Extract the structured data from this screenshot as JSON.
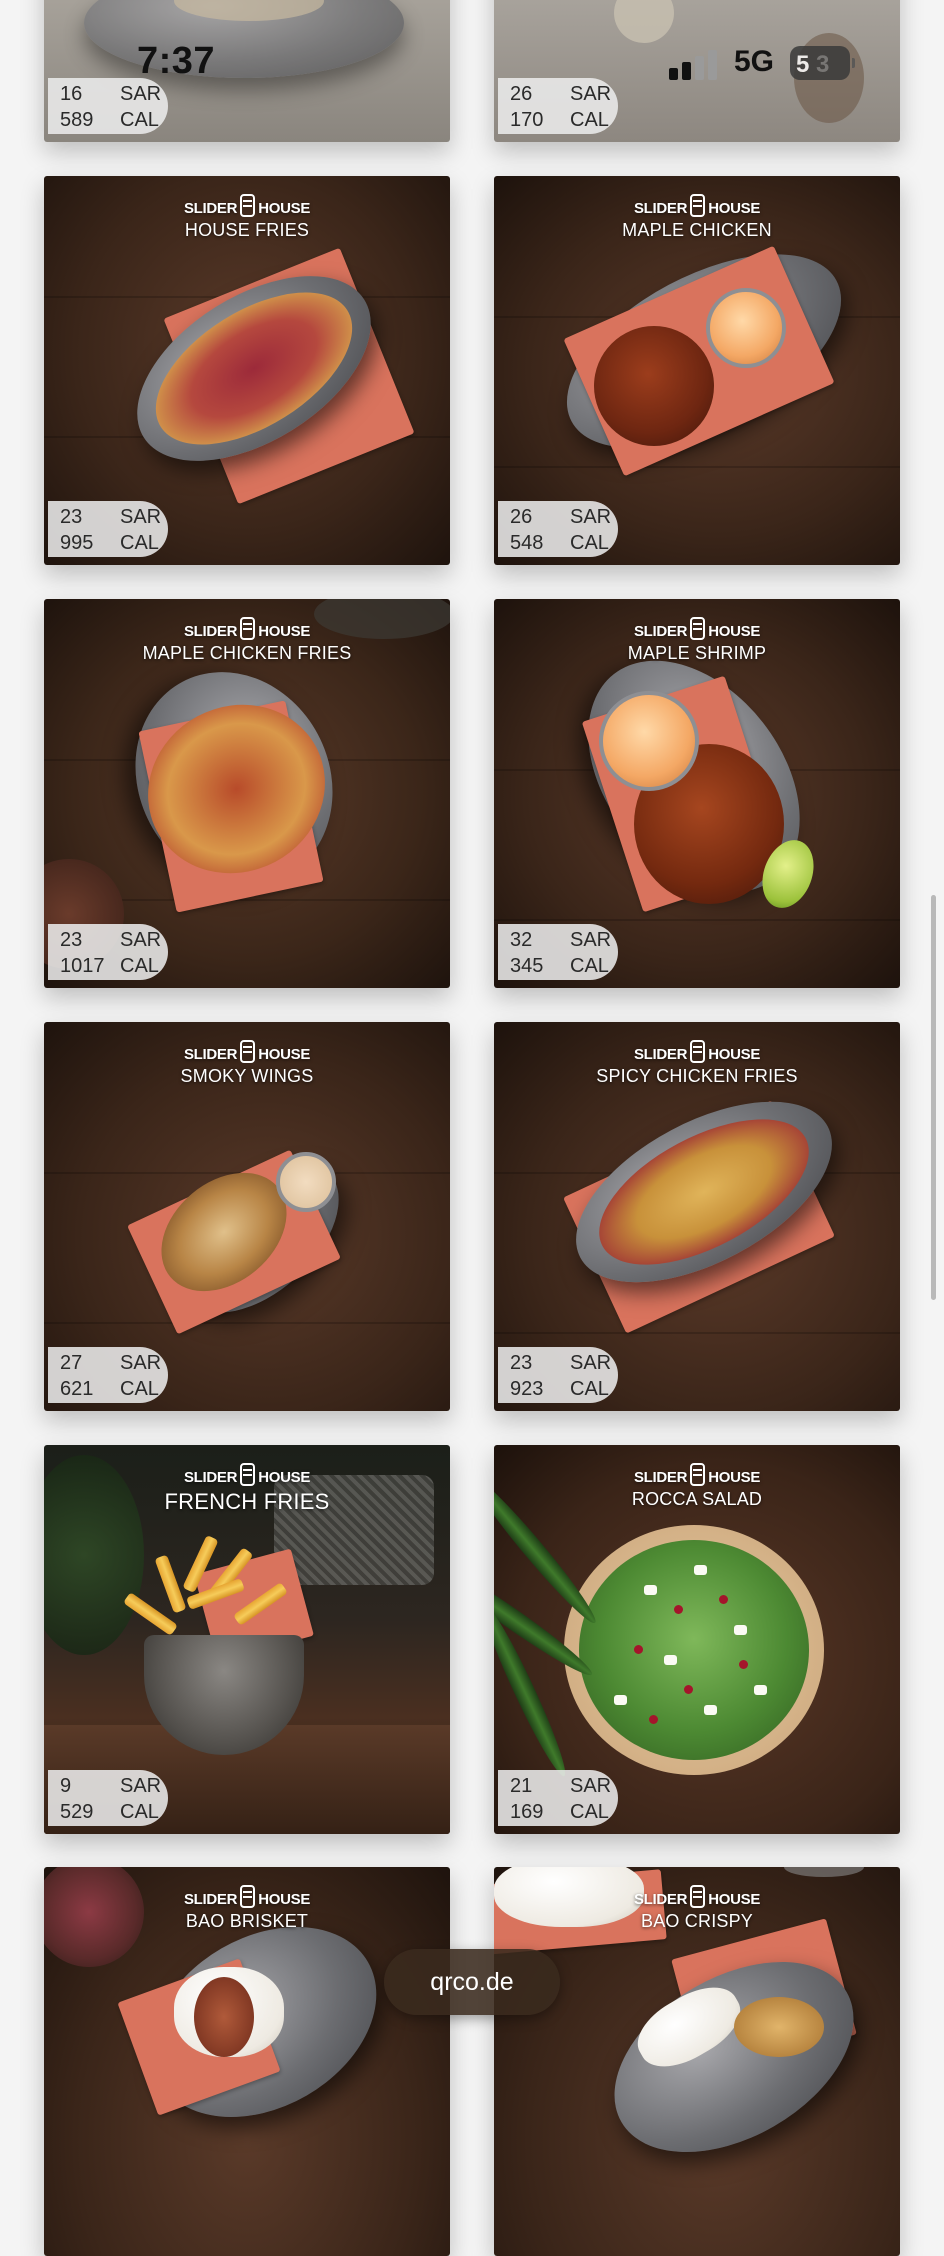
{
  "status_bar": {
    "time": "7:37",
    "network": "5G",
    "battery_level": "5",
    "battery_suffix": "3"
  },
  "brand": {
    "left_word": "SLIDER",
    "right_word": "HOUSE"
  },
  "menu": {
    "items": [
      {
        "name": "",
        "price": "16",
        "currency": "SAR",
        "calories": "589",
        "cal_unit": "CAL"
      },
      {
        "name": "",
        "price": "26",
        "currency": "SAR",
        "calories": "170",
        "cal_unit": "CAL"
      },
      {
        "name": "HOUSE FRIES",
        "price": "23",
        "currency": "SAR",
        "calories": "995",
        "cal_unit": "CAL"
      },
      {
        "name": "MAPLE CHICKEN",
        "price": "26",
        "currency": "SAR",
        "calories": "548",
        "cal_unit": "CAL"
      },
      {
        "name": "MAPLE CHICKEN FRIES",
        "price": "23",
        "currency": "SAR",
        "calories": "1017",
        "cal_unit": "CAL"
      },
      {
        "name": "MAPLE SHRIMP",
        "price": "32",
        "currency": "SAR",
        "calories": "345",
        "cal_unit": "CAL"
      },
      {
        "name": "SMOKY WINGS",
        "price": "27",
        "currency": "SAR",
        "calories": "621",
        "cal_unit": "CAL"
      },
      {
        "name": "SPICY CHICKEN FRIES",
        "price": "23",
        "currency": "SAR",
        "calories": "923",
        "cal_unit": "CAL"
      },
      {
        "name": "FRENCH FRIES",
        "price": "9",
        "currency": "SAR",
        "calories": "529",
        "cal_unit": "CAL"
      },
      {
        "name": "ROCCA SALAD",
        "price": "21",
        "currency": "SAR",
        "calories": "169",
        "cal_unit": "CAL"
      },
      {
        "name": "BAO BRISKET"
      },
      {
        "name": "BAO CRISPY"
      }
    ]
  },
  "browser": {
    "url": "qrco.de"
  },
  "colors": {
    "wood_dark": "#2b1a12",
    "wood_mid": "#4a2e20",
    "paper": "#d9735d",
    "pill_bg": "#ebebeb"
  }
}
